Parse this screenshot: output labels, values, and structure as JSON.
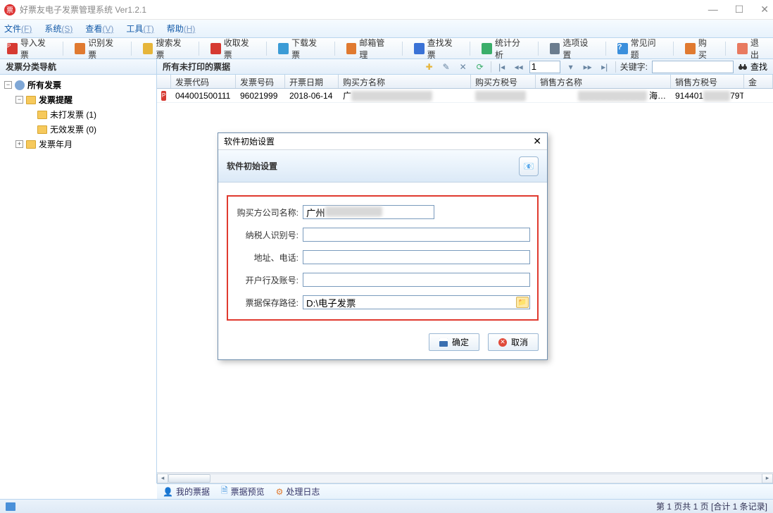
{
  "app": {
    "title": "好票友电子发票管理系统 Ver1.2.1"
  },
  "window_controls": {
    "min": "—",
    "max": "☐",
    "close": "✕"
  },
  "menu": {
    "items": [
      {
        "label": "文件",
        "accel": "(F)"
      },
      {
        "label": "系统",
        "accel": "(S)"
      },
      {
        "label": "查看",
        "accel": "(V)"
      },
      {
        "label": "工具",
        "accel": "(T)"
      },
      {
        "label": "帮助",
        "accel": "(H)"
      }
    ]
  },
  "toolbar": {
    "items": [
      {
        "label": "导入发票",
        "icon": "pdf",
        "color": "#d63a32"
      },
      {
        "label": "识别发票",
        "icon": "scan",
        "color": "#e07a30"
      },
      {
        "label": "搜索发票",
        "icon": "search",
        "color": "#e6b53a"
      },
      {
        "label": "收取发票",
        "icon": "inbox",
        "color": "#d63a32"
      },
      {
        "label": "下载发票",
        "icon": "download",
        "color": "#3a9bd6"
      },
      {
        "label": "邮箱管理",
        "icon": "mail",
        "color": "#e07a30"
      },
      {
        "label": "查找发票",
        "icon": "find",
        "color": "#3a72d6"
      },
      {
        "label": "统计分析",
        "icon": "chart",
        "color": "#3aae6a"
      },
      {
        "label": "选项设置",
        "icon": "options",
        "color": "#6a7c8e"
      },
      {
        "label": "常见问题",
        "icon": "faq",
        "color": "#3a8fdc"
      },
      {
        "label": "购买",
        "icon": "buy",
        "color": "#e07a30"
      },
      {
        "label": "退出",
        "icon": "exit",
        "color": "#e87a60"
      }
    ]
  },
  "nav": {
    "title": "发票分类导航",
    "tree": {
      "root": {
        "label": "所有发票"
      },
      "reminder": {
        "label": "发票提醒"
      },
      "unprinted": {
        "label": "未打发票 (1)"
      },
      "invalid": {
        "label": "无效发票 (0)"
      },
      "byyear": {
        "label": "发票年月"
      }
    }
  },
  "content": {
    "title": "所有未打印的票据",
    "pager": {
      "page": "1",
      "keyword_label": "关键字:",
      "search_label": "查找"
    },
    "columns": {
      "code": "发票代码",
      "num": "发票号码",
      "date": "开票日期",
      "buyer": "购买方名称",
      "buyertax": "购买方税号",
      "seller": "销售方名称",
      "sellertax": "销售方税号",
      "amt": "金"
    },
    "rows": [
      {
        "code": "044001500111",
        "num": "96021999",
        "date": "2018-06-14",
        "buyer_prefix": "广",
        "buyer_blur": "█████████████",
        "buyertax_blur": "████████",
        "seller_blur": "███████████",
        "seller_suffix": "海…",
        "sellertax_prefix": "914401",
        "sellertax_blur": "████",
        "sellertax_suffix": "79T"
      }
    ]
  },
  "bottom_tabs": {
    "mytickets": "我的票据",
    "preview": "票据预览",
    "log": "处理日志"
  },
  "statusbar": {
    "page_info": "第 1 页共 1 页 [合计 1 条记录]"
  },
  "dialog": {
    "window_title": "软件初始设置",
    "banner_title": "软件初始设置",
    "fields": {
      "company": {
        "label": "购买方公司名称:",
        "value_prefix": "广州",
        "value_blur": "█████████"
      },
      "taxid": {
        "label": "纳税人识别号:",
        "value": ""
      },
      "addr": {
        "label": "地址、电话:",
        "value": ""
      },
      "bank": {
        "label": "开户行及账号:",
        "value": ""
      },
      "path": {
        "label": "票据保存路径:",
        "value": "D:\\电子发票"
      }
    },
    "ok": "确定",
    "cancel": "取消"
  }
}
